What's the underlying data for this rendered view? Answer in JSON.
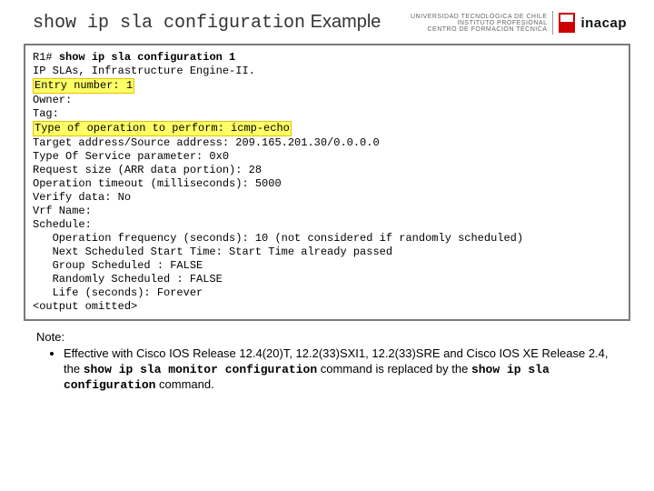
{
  "header": {
    "title_cmd": "show ip sla configuration",
    "title_suffix": " Example",
    "logo_text_l1": "UNIVERSIDAD TECNOLÓGICA DE CHILE",
    "logo_text_l2": "INSTITUTO PROFESIONAL",
    "logo_text_l3": "CENTRO DE FORMACIÓN TÉCNICA",
    "brand": "inacap"
  },
  "output": {
    "l01_prompt": "R1# ",
    "l01_cmd": "show ip sla configuration 1",
    "l02": "IP SLAs, Infrastructure Engine-II.",
    "l03_hl": "Entry number: 1",
    "l04": "Owner:",
    "l05": "Tag:",
    "l06_hl": "Type of operation to perform: icmp-echo",
    "l07": "Target address/Source address: 209.165.201.30/0.0.0.0",
    "l08": "Type Of Service parameter: 0x0",
    "l09": "Request size (ARR data portion): 28",
    "l10": "Operation timeout (milliseconds): 5000",
    "l11": "Verify data: No",
    "l12": "Vrf Name:",
    "l13": "Schedule:",
    "l14": "   Operation frequency (seconds): 10 (not considered if randomly scheduled)",
    "l15": "   Next Scheduled Start Time: Start Time already passed",
    "l16": "   Group Scheduled : FALSE",
    "l17": "   Randomly Scheduled : FALSE",
    "l18": "   Life (seconds): Forever",
    "l19": "<output omitted>"
  },
  "note": {
    "label": "Note:",
    "bullet_prefix": "Effective with Cisco IOS Release 12.4(20)T, 12.2(33)SXI1, 12.2(33)SRE and Cisco IOS XE Release 2.4, the ",
    "cmd_old": "show ip sla monitor configuration",
    "bullet_mid": " command is replaced by the ",
    "cmd_new": "show ip sla configuration",
    "bullet_suffix": " command."
  }
}
